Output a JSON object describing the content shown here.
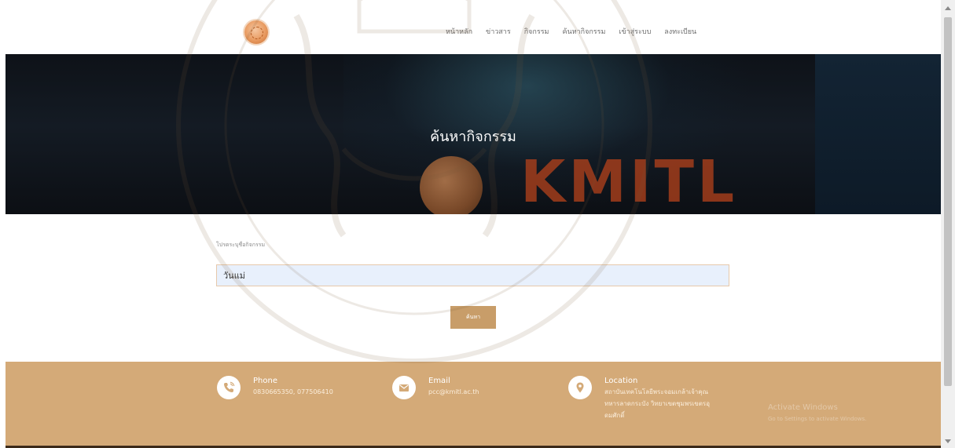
{
  "nav": {
    "links": [
      "หน้าหลัก",
      "ข่าวสาร",
      "กิจกรรม",
      "ค้นหากิจกรรม",
      "เข้าสู่ระบบ",
      "ลงทะเบียน"
    ]
  },
  "hero": {
    "title": "ค้นหากิจกรรม",
    "brand": "KMITL"
  },
  "search": {
    "label": "โปรดระบุชื่อกิจกรรม",
    "value": "วันแม่",
    "button_label": "ค้นหา"
  },
  "footer": {
    "phone": {
      "title": "Phone",
      "value": "0830665350, 077506410"
    },
    "email": {
      "title": "Email",
      "value": "pcc@kmitl.ac.th"
    },
    "location": {
      "title": "Location",
      "lines": [
        "สถาบันเทคโนโลยีพระจอมเกล้าเจ้าคุณ",
        "ทหารลาดกระบัง วิทยาเขตชุมพรเขตรอุ",
        "ดมศักดิ์"
      ]
    },
    "watermark_text": "Activate Windows",
    "watermark_sub": "Go to Settings to activate Windows."
  },
  "colors": {
    "accent": "#c89d69",
    "footer_bg": "#d4aa78",
    "hero_bg": "#141b24",
    "brand": "#b5421b"
  },
  "icons": {
    "phone": "phone-icon",
    "email": "envelope-icon",
    "location": "map-pin-icon",
    "logo": "university-seal-logo"
  }
}
